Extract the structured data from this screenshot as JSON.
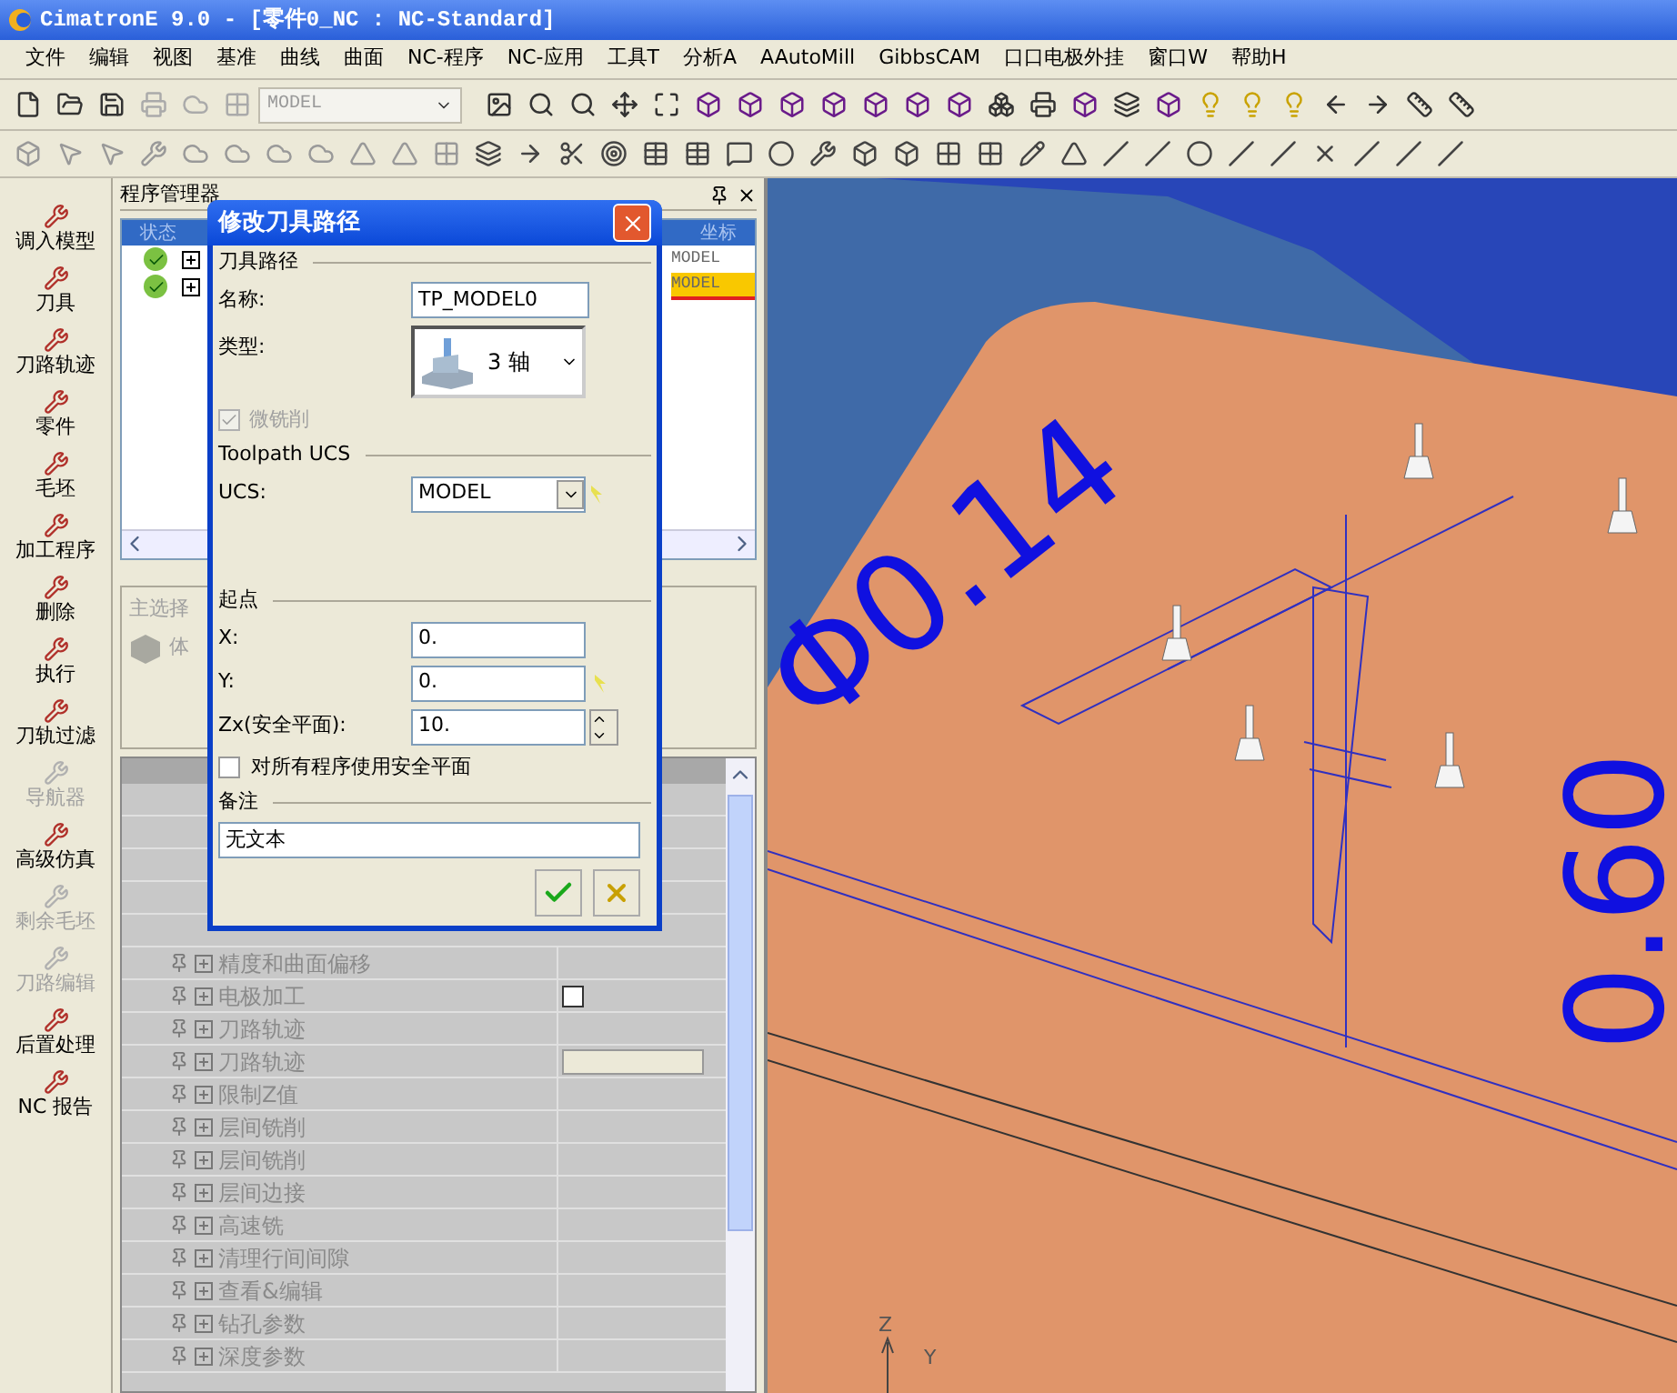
{
  "window": {
    "title": "CimatronE 9.0 - [零件0_NC : NC-Standard]"
  },
  "menu": [
    "文件",
    "编辑",
    "视图",
    "基准",
    "曲线",
    "曲面",
    "NC-程序",
    "NC-应用",
    "工具T",
    "分析A",
    "AAutoMill",
    "GibbsCAM",
    "口口电极外挂",
    "窗口W",
    "帮助H"
  ],
  "toolbar": {
    "combo": "MODEL"
  },
  "sidebar": {
    "items": [
      {
        "label": "调入模型",
        "disabled": false
      },
      {
        "label": "刀具",
        "disabled": false
      },
      {
        "label": "刀路轨迹",
        "disabled": false
      },
      {
        "label": "零件",
        "disabled": false
      },
      {
        "label": "毛坯",
        "disabled": false
      },
      {
        "label": "加工程序",
        "disabled": false
      },
      {
        "label": "删除",
        "disabled": false
      },
      {
        "label": "执行",
        "disabled": false
      },
      {
        "label": "刀轨过滤",
        "disabled": false
      },
      {
        "label": "导航器",
        "disabled": true
      },
      {
        "label": "高级仿真",
        "disabled": false
      },
      {
        "label": "剩余毛坯",
        "disabled": true
      },
      {
        "label": "刀路编辑",
        "disabled": true
      },
      {
        "label": "后置处理",
        "disabled": false
      },
      {
        "label": "NC 报告",
        "disabled": false
      }
    ]
  },
  "program_manager": {
    "title": "程序管理器",
    "columns": [
      "状态",
      "坐标"
    ],
    "rows": [
      {
        "ok": true,
        "ucs": "MODEL",
        "selected": false
      },
      {
        "ok": true,
        "ucs": "MODEL",
        "selected": true
      }
    ]
  },
  "selection_panel": {
    "title": "主选择",
    "item": "体"
  },
  "parameters": {
    "rows": [
      {
        "label": "精度和曲面偏移",
        "kind": "plain"
      },
      {
        "label": "电极加工",
        "kind": "checkbox",
        "checked": false
      },
      {
        "label": "刀路轨迹",
        "kind": "plain"
      },
      {
        "label": "刀路轨迹",
        "kind": "button"
      },
      {
        "label": "限制Z值",
        "kind": "plain"
      },
      {
        "label": "层间铣削",
        "kind": "plain"
      },
      {
        "label": "层间铣削",
        "kind": "plain"
      },
      {
        "label": "层间边接",
        "kind": "plain"
      },
      {
        "label": "高速铣",
        "kind": "plain"
      },
      {
        "label": "清理行间间隙",
        "kind": "plain"
      },
      {
        "label": "查看&编辑",
        "kind": "plain"
      },
      {
        "label": "钻孔参数",
        "kind": "plain"
      },
      {
        "label": "深度参数",
        "kind": "plain"
      }
    ]
  },
  "dialog": {
    "title": "修改刀具路径",
    "toolpath_group": "刀具路径",
    "name_label": "名称:",
    "name_value": "TP_MODEL0",
    "type_label": "类型:",
    "type_value": "3 轴",
    "micro_milling": {
      "label": "微铣削",
      "checked": true,
      "disabled": true
    },
    "ucs_group": "Toolpath UCS",
    "ucs_label": "UCS:",
    "ucs_value": "MODEL",
    "start_group": "起点",
    "x_label": "X:",
    "x_value": "0.",
    "y_label": "Y:",
    "y_value": "0.",
    "z_label": "Zx(安全平面):",
    "z_value": "10.",
    "use_safe_plane": {
      "label": "对所有程序使用安全平面",
      "checked": false
    },
    "notes_group": "备注",
    "notes_value": "无文本"
  },
  "viewport": {
    "annotations": [
      "Φ0.14",
      "0.60"
    ],
    "axes": [
      "Z",
      "Y"
    ]
  }
}
